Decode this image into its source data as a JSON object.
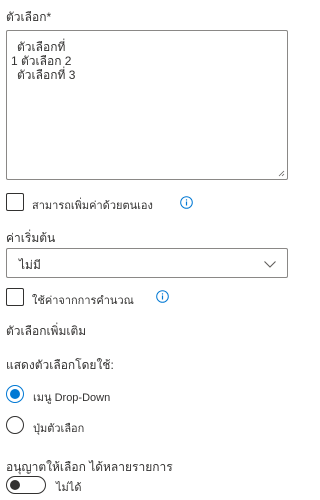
{
  "choices": {
    "label": "ตัวเลือก",
    "required_marker": "*",
    "lines": [
      "ตัวเลือกที่",
      "1 ตัวเลือก 2",
      "ตัวเลือกที่ 3"
    ]
  },
  "fill_in": {
    "label": "สามารถเพิ่มค่าด้วยตนเอง",
    "checked": false,
    "info_icon": "info-icon"
  },
  "default_value": {
    "label": "ค่าเริ่มต้น",
    "selected": "ไม่มี",
    "chevron_icon": "chevron-down-icon"
  },
  "calculated": {
    "label": "ใช้ค่าจากการคำนวณ",
    "checked": false,
    "info_icon": "info-icon"
  },
  "more_options": {
    "heading": "ตัวเลือกเพิ่มเติม"
  },
  "display_choices": {
    "label": "แสดงตัวเลือกโดยใช้:",
    "options": [
      {
        "label": "เมนู Drop-Down",
        "checked": true
      },
      {
        "label": "ปุ่มตัวเลือก",
        "checked": false
      }
    ]
  },
  "multi_select": {
    "label": "อนุญาตให้เลือก ได้หลายรายการ",
    "toggle_state_label": "ไม่ได้",
    "on": false
  },
  "colors": {
    "accent": "#0078d4",
    "text": "#323130",
    "border": "#8a8886",
    "info": "#0078d4"
  }
}
